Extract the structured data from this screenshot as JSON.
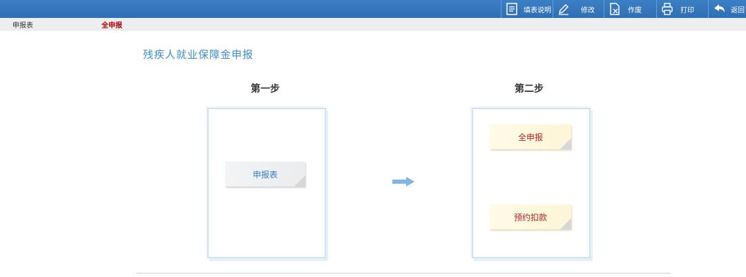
{
  "toolbar": {
    "items": [
      {
        "label": "填表说明",
        "icon": "document-icon"
      },
      {
        "label": "修改",
        "icon": "pencil-icon"
      },
      {
        "label": "作废",
        "icon": "void-document-icon"
      },
      {
        "label": "打印",
        "icon": "printer-icon"
      },
      {
        "label": "返回",
        "icon": "return-arrow-icon"
      }
    ]
  },
  "breadcrumb": {
    "item1": "申报表",
    "item2": "全申报"
  },
  "main": {
    "title": "残疾人就业保障金申报",
    "step1": {
      "title": "第一步",
      "button": "申报表"
    },
    "step2": {
      "title": "第二步",
      "button_full": "全申报",
      "button_deduct": "预约扣款"
    }
  },
  "colors": {
    "toolbar_bg": "#2f6fb3",
    "title_blue": "#3a8fd6",
    "accent_red": "#c00000",
    "arrow_blue": "#7fb6e4"
  }
}
